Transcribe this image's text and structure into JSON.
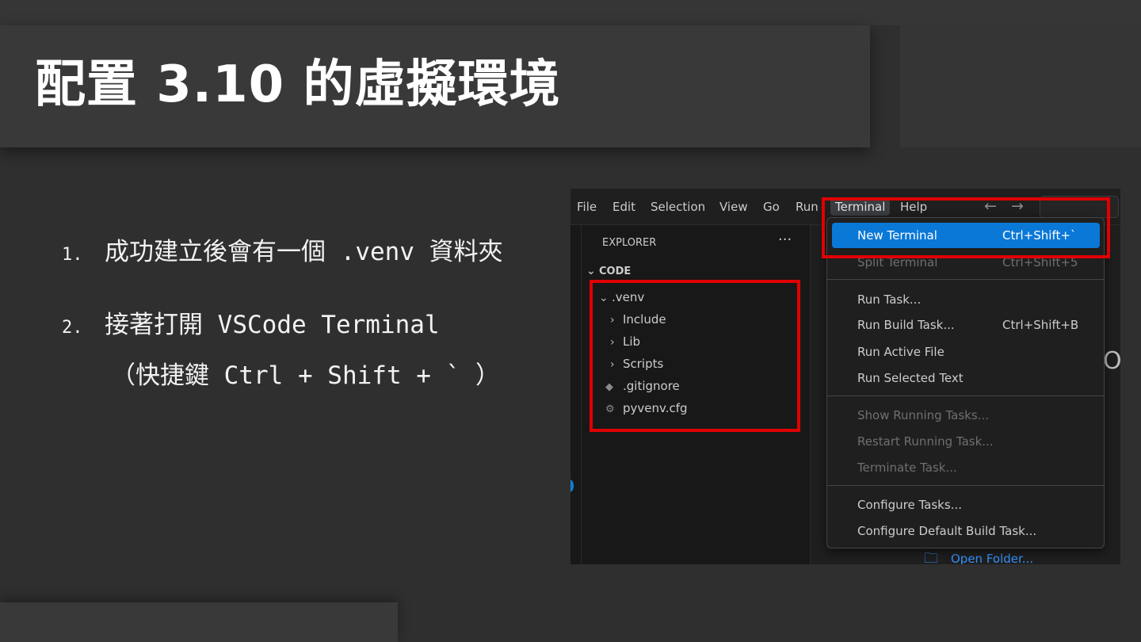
{
  "slide": {
    "title": "配置 3.10 的虛擬環境",
    "bullets": [
      {
        "num": "1.",
        "text": "成功建立後會有一個 .venv 資料夾"
      },
      {
        "num": "2.",
        "text": "接著打開 VSCode Terminal"
      },
      {
        "num": "",
        "text": "（快捷鍵 Ctrl + Shift + ` ）"
      }
    ]
  },
  "vscode": {
    "menubar": {
      "items": [
        "File",
        "Edit",
        "Selection",
        "View",
        "Go",
        "Run",
        "Terminal",
        "Help"
      ],
      "back_arrow": "←",
      "forward_arrow": "→"
    },
    "explorer": {
      "title": "EXPLORER",
      "more": "···",
      "folder": "CODE",
      "tree": [
        {
          "label": ".venv",
          "chevron": "⌄"
        },
        {
          "label": "Include",
          "chevron": "›"
        },
        {
          "label": "Lib",
          "chevron": "›"
        },
        {
          "label": "Scripts",
          "chevron": "›"
        },
        {
          "label": ".gitignore",
          "icon": "◆"
        },
        {
          "label": "pyvenv.cfg",
          "icon": "⚙"
        }
      ]
    },
    "terminal_menu": {
      "new_terminal": {
        "label": "New Terminal",
        "shortcut": "Ctrl+Shift+`"
      },
      "split_terminal": {
        "label": "Split Terminal",
        "shortcut": "Ctrl+Shift+5"
      },
      "run_task": "Run Task...",
      "run_build_task": {
        "label": "Run Build Task...",
        "shortcut": "Ctrl+Shift+B"
      },
      "run_active_file": "Run Active File",
      "run_selected_text": "Run Selected Text",
      "show_running_tasks": "Show Running Tasks...",
      "restart_running_task": "Restart Running Task...",
      "terminate_task": "Terminate Task...",
      "configure_tasks": "Configure Tasks...",
      "configure_default_build_task": "Configure Default Build Task..."
    },
    "editor": {
      "peek_char": "O",
      "open_folder": "Open Folder..."
    }
  },
  "colors": {
    "highlight_box": "#e00000",
    "menu_selection": "#0a78d7",
    "link": "#3794ff"
  }
}
